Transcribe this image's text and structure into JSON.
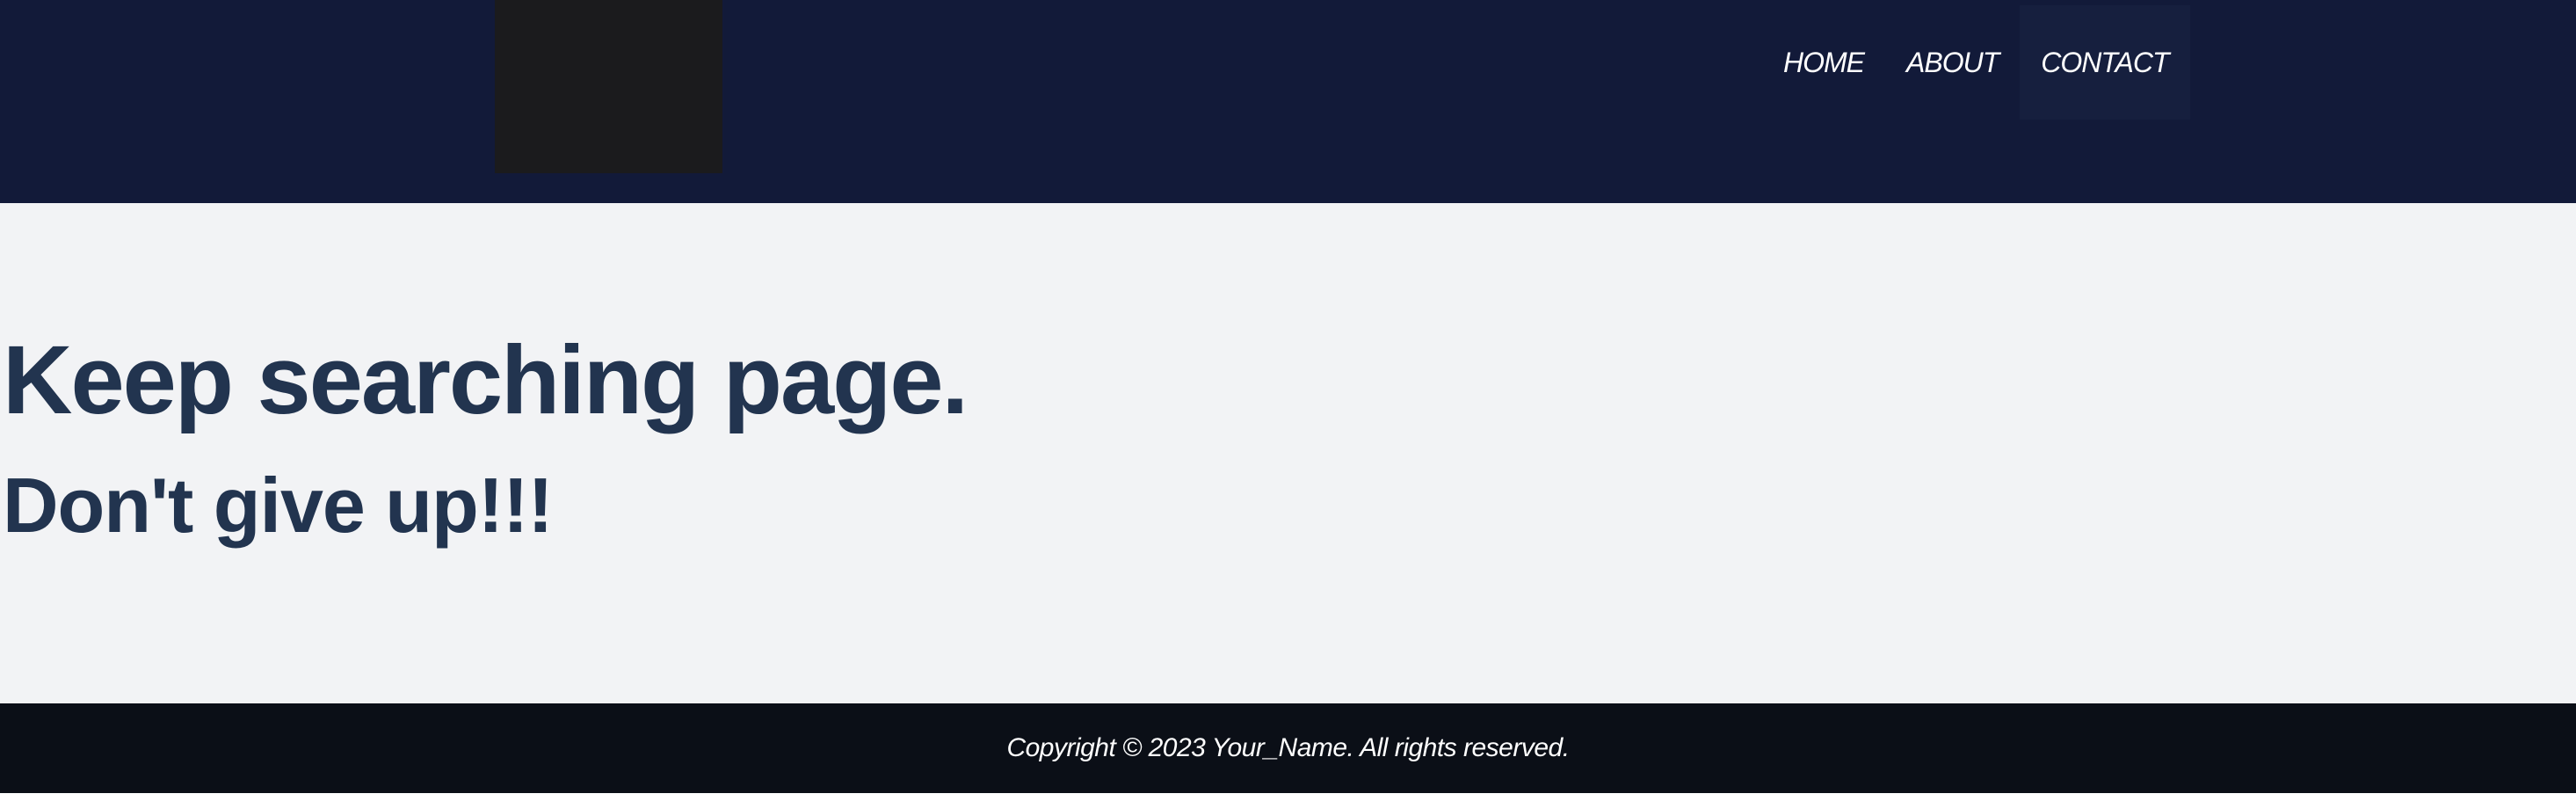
{
  "header": {
    "logo_alt": "",
    "nav": [
      {
        "label": "HOME"
      },
      {
        "label": "ABOUT"
      },
      {
        "label": "CONTACT"
      }
    ]
  },
  "main": {
    "title": "Keep searching page.",
    "subtitle": "Don't give up!!!"
  },
  "footer": {
    "copyright": "Copyright © 2023 Your_Name. All rights reserved."
  },
  "colors": {
    "header_bg": "#121a39",
    "main_bg": "#f2f3f5",
    "heading_text": "#22344f",
    "footer_bg": "#0b0f17",
    "nav_active_bg": "#161f3e"
  }
}
